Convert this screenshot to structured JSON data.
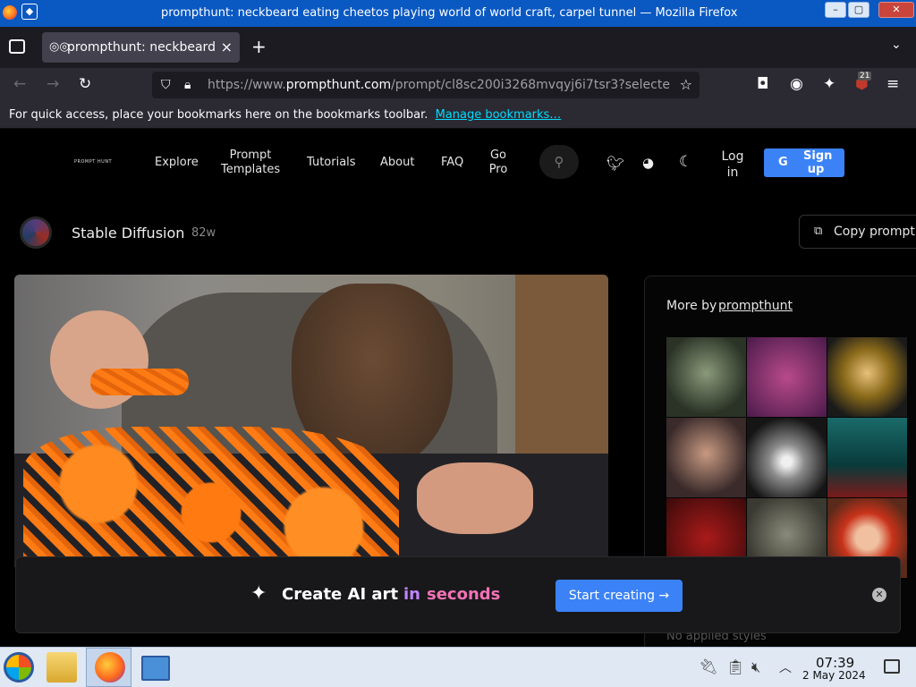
{
  "window": {
    "title": "prompthunt: neckbeard eating cheetos playing world of world craft, carpel tunnel — Mozilla Firefox",
    "buttons": {
      "minimize": "–",
      "maximize": "▢",
      "close": "✕"
    }
  },
  "tabs": [
    {
      "label": "prompthunt: neckbeard",
      "close": "×"
    }
  ],
  "new_tab": "+",
  "address_bar": {
    "url_prefix": "https://www.",
    "url_domain": "prompthunt.com",
    "url_rest": "/prompt/cl8sc200i3268mvqyj6i7tsr3?selecte"
  },
  "toolbar": {
    "extension_badge": "21"
  },
  "bookmarks_bar": {
    "text": "For quick access, place your bookmarks here on the bookmarks toolbar.",
    "link": "Manage bookmarks…"
  },
  "site": {
    "logo": "PROMPT HUNT",
    "nav": [
      "Explore",
      "Prompt Templates",
      "Tutorials",
      "About",
      "FAQ",
      "Go Pro"
    ],
    "login": "Log in",
    "signup": "Sign up",
    "signup_icon": "G"
  },
  "prompt": {
    "model": "Stable Diffusion",
    "age": "82w",
    "copy_label": "Copy prompt"
  },
  "sidebar": {
    "more_by": "More by",
    "author": "prompthunt",
    "footer_text": "No applied styles"
  },
  "banner": {
    "text_main": "Create AI art",
    "text_mid": "in",
    "text_accent": "seconds",
    "cta": "Start creating",
    "cta_icon": "→"
  },
  "taskbar": {
    "time": "07:39",
    "date": "2 May 2024"
  },
  "colors": {
    "accent_blue": "#3b82f6",
    "banner_gradient_start": "#c084fc",
    "banner_gradient_end": "#f472b6"
  }
}
